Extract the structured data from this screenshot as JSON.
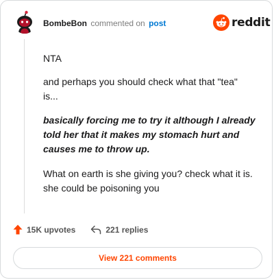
{
  "header": {
    "username": "BombeBon",
    "verb": "commented on",
    "post_link": "post",
    "avatar_icon": "snoo-avatar-icon",
    "brand": "reddit",
    "brand_icon": "reddit-alien-icon"
  },
  "comment": {
    "p1": "NTA",
    "p2": "and perhaps you should check what that \"tea\" is...",
    "p3": "basically forcing me to try it although I already told her that it makes my stomach hurt and causes me to throw up.",
    "p4": "What on earth is she giving you? check what it is. she could be poisoning you"
  },
  "stats": {
    "upvotes": "15K upvotes",
    "upvote_icon": "upvote-arrow-icon",
    "replies": "221 replies",
    "reply_icon": "reply-arrow-icon"
  },
  "cta": {
    "view_label": "View 221 comments"
  },
  "colors": {
    "accent": "#ff4500",
    "link": "#0079d3",
    "text": "#1a1a1b",
    "muted": "#7c7c7c",
    "border": "#d7dadc"
  }
}
